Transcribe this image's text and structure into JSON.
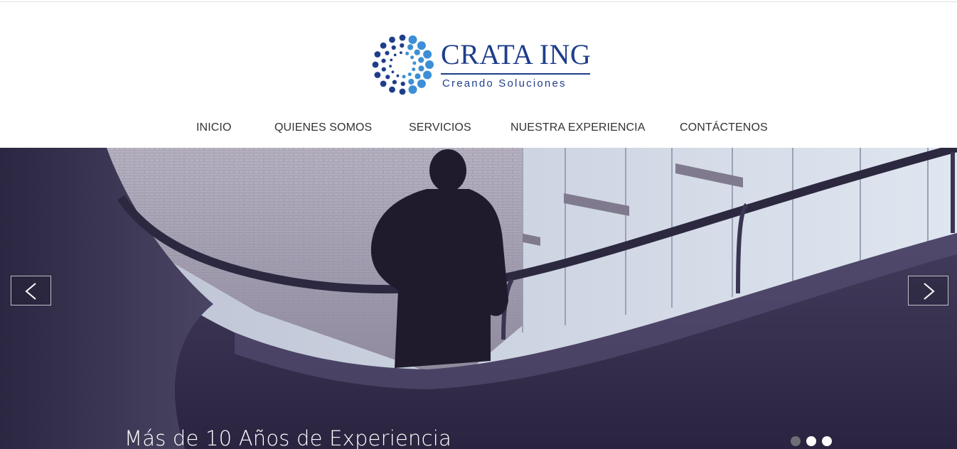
{
  "brand": {
    "name": "CRATA ING",
    "tagline": "Creando Soluciones",
    "color": "#1f3e8a",
    "accent": "#3c8fd6"
  },
  "nav": {
    "items": [
      {
        "label": "INICIO"
      },
      {
        "label": "QUIENES SOMOS"
      },
      {
        "label": "SERVICIOS"
      },
      {
        "label": "NUESTRA EXPERIENCIA"
      },
      {
        "label": "CONTÁCTENOS"
      }
    ]
  },
  "slider": {
    "caption": "Más de 10 Años de Experiencia",
    "prev_icon": "chevron-left-icon",
    "next_icon": "chevron-right-icon",
    "slide_count": 3,
    "active_slide": 1
  }
}
